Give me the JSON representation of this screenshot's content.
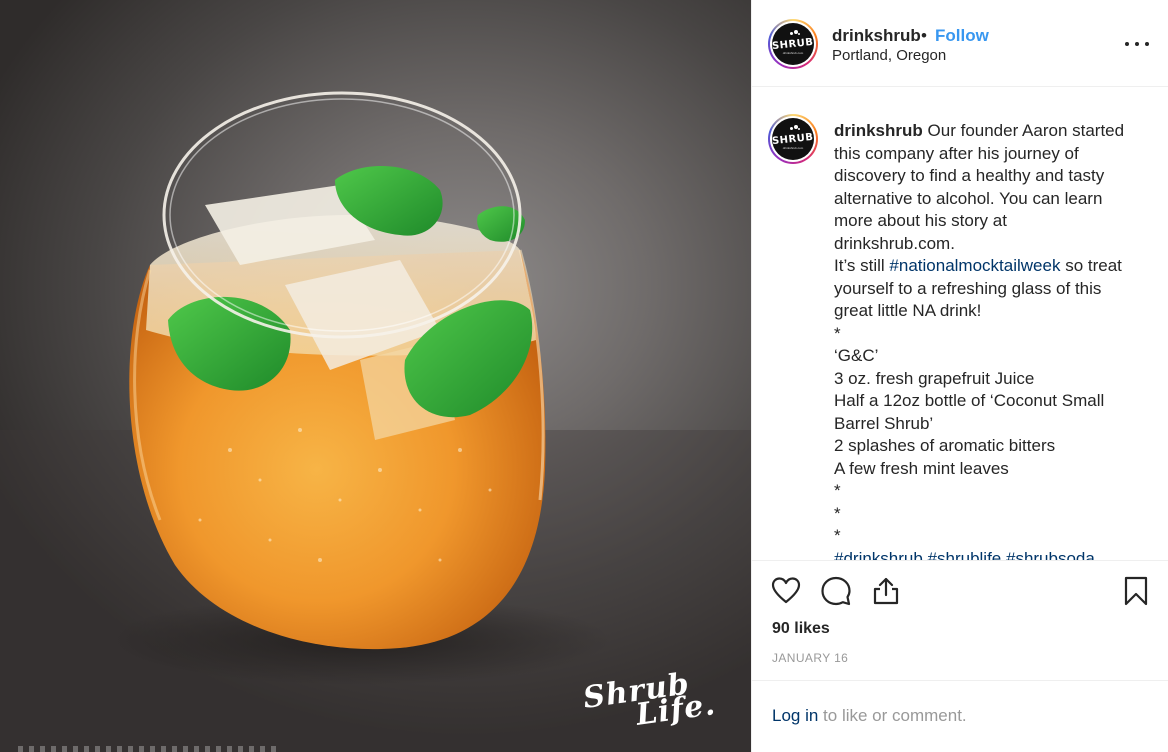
{
  "post": {
    "username": "drinkshrub",
    "separator": "•",
    "follow_label": "Follow",
    "location": "Portland, Oregon",
    "avatar_logo": "SHRUB",
    "avatar_sub": "drinkshrub.com"
  },
  "photo": {
    "watermark_line1": "Shrub",
    "watermark_line2": "Life."
  },
  "caption": {
    "username": "drinkshrub",
    "lines": [
      "Our founder Aaron started",
      "this company after his journey of",
      "discovery to find a healthy and tasty",
      "alternative to alcohol. You can learn",
      "more about his story at",
      "drinkshrub.com."
    ],
    "line_still_pre": "It’s still ",
    "hashtag_main": "#nationalmocktailweek",
    "line_still_post": " so treat",
    "lines2": [
      "yourself to a refreshing glass of this",
      "great little NA drink!",
      "*",
      "‘G&C’",
      "3 oz. fresh grapefruit Juice",
      "Half a 12oz bottle of ‘Coconut Small",
      "Barrel Shrub’",
      "2 splashes of aromatic bitters",
      "A few fresh mint leaves",
      "*",
      "*",
      "*"
    ],
    "tags_cut": "#drinkshrub #shrublife #shrubsoda"
  },
  "actions": {
    "likes": "90 likes",
    "date": "JANUARY 16",
    "icons": [
      "heart-icon",
      "comment-icon",
      "share-icon",
      "bookmark-icon"
    ]
  },
  "login": {
    "link_label": "Log in",
    "rest": " to like or comment."
  },
  "colors": {
    "link_blue": "#3897f0",
    "hashtag_navy": "#003569",
    "muted_gray": "#999999",
    "text_dark": "#262626",
    "border": "#efefef"
  }
}
